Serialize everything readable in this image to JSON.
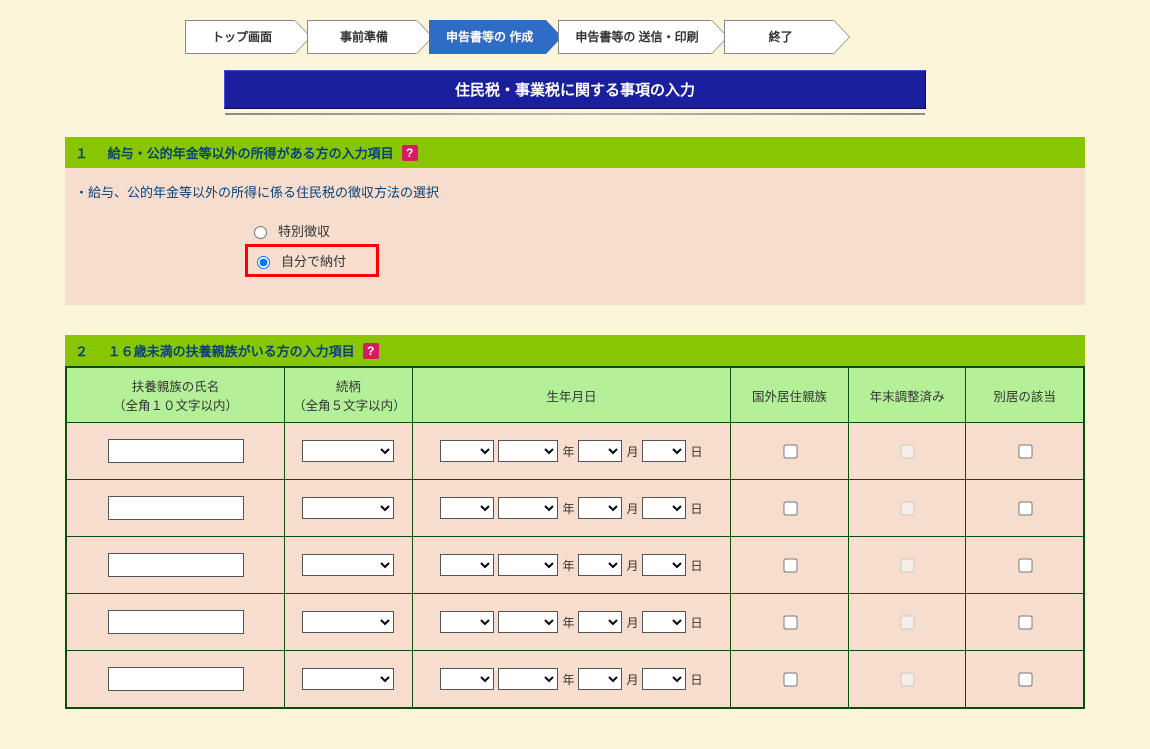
{
  "breadcrumbs": [
    "トップ画面",
    "事前準備",
    "申告書等の\n作成",
    "申告書等の\n送信・印刷",
    "終了"
  ],
  "title": "住民税・事業税に関する事項の入力",
  "helpGlyph": "?",
  "section1": {
    "num": "１",
    "title": "給与・公的年金等以外の所得がある方の入力項目",
    "note": "・給与、公的年金等以外の所得に係る住民税の徴収方法の選択",
    "radio1": "特別徴収",
    "radio2": "自分で納付"
  },
  "section2": {
    "num": "２",
    "title": "１６歳未満の扶養親族がいる方の入力項目",
    "headers": {
      "name1": "扶養親族の氏名",
      "name2": "（全角１０文字以内）",
      "rel1": "続柄",
      "rel2": "（全角５文字以内）",
      "dob": "生年月日",
      "abroad": "国外居住親族",
      "adjusted": "年末調整済み",
      "separate": "別居の該当"
    },
    "dobLabels": {
      "year": "年",
      "month": "月",
      "day": "日"
    },
    "rowCount": 5
  }
}
